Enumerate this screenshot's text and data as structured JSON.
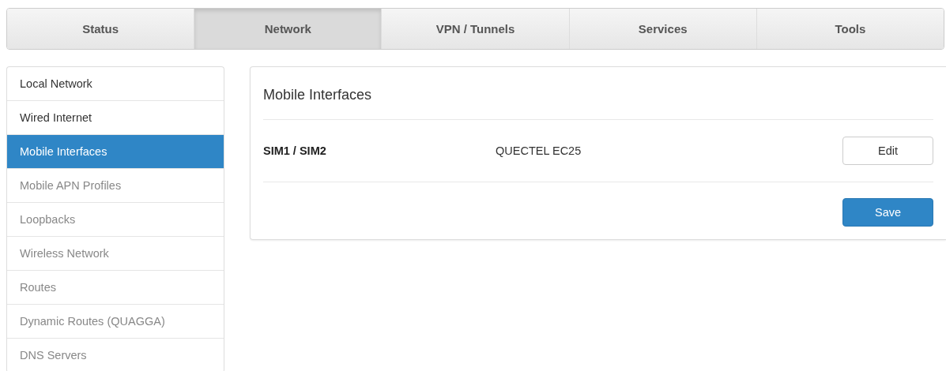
{
  "tabs": [
    {
      "label": "Status",
      "selected": false
    },
    {
      "label": "Network",
      "selected": true
    },
    {
      "label": "VPN / Tunnels",
      "selected": false
    },
    {
      "label": "Services",
      "selected": false
    },
    {
      "label": "Tools",
      "selected": false
    }
  ],
  "sidebar": {
    "items": [
      {
        "label": "Local Network",
        "selected": false,
        "dimmed": false
      },
      {
        "label": "Wired Internet",
        "selected": false,
        "dimmed": false
      },
      {
        "label": "Mobile Interfaces",
        "selected": true,
        "dimmed": false
      },
      {
        "label": "Mobile APN Profiles",
        "selected": false,
        "dimmed": true
      },
      {
        "label": "Loopbacks",
        "selected": false,
        "dimmed": true
      },
      {
        "label": "Wireless Network",
        "selected": false,
        "dimmed": true
      },
      {
        "label": "Routes",
        "selected": false,
        "dimmed": true
      },
      {
        "label": "Dynamic Routes (QUAGGA)",
        "selected": false,
        "dimmed": true
      },
      {
        "label": "DNS Servers",
        "selected": false,
        "dimmed": true
      }
    ]
  },
  "panel": {
    "title": "Mobile Interfaces",
    "rows": [
      {
        "name": "SIM1 / SIM2",
        "module": "QUECTEL EC25",
        "action": "Edit"
      }
    ],
    "save": "Save"
  }
}
